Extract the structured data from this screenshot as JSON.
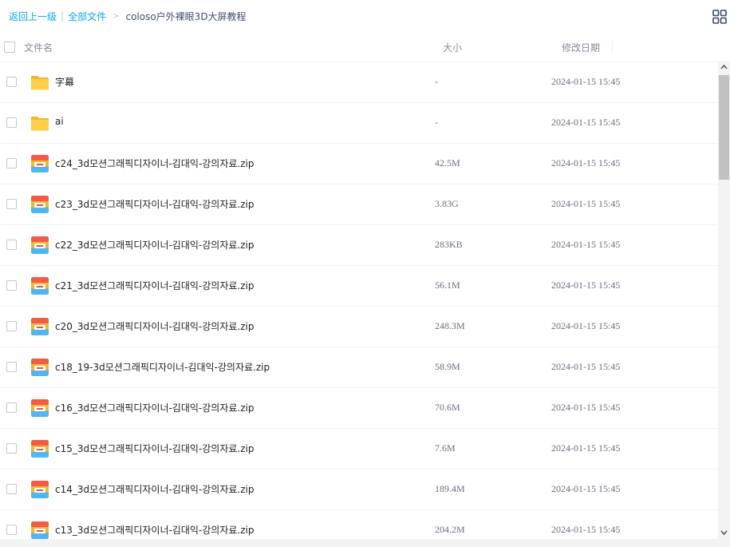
{
  "breadcrumb": {
    "back": "返回上一级",
    "separator": "|",
    "all_files": "全部文件",
    "arrow": ">",
    "current": "coloso户外裸眼3D大屏教程"
  },
  "header": {
    "name": "文件名",
    "size": "大小",
    "date": "修改日期"
  },
  "files": [
    {
      "icon": "folder-icon",
      "name": "字幕",
      "size": "-",
      "date": "2024-01-15 15:45"
    },
    {
      "icon": "folder-icon",
      "name": "ai",
      "size": "-",
      "date": "2024-01-15 15:45"
    },
    {
      "icon": "zip-icon",
      "name": "c24_3d모션그래픽디자이너-김대익-강의자료.zip",
      "size": "42.5M",
      "date": "2024-01-15 15:45"
    },
    {
      "icon": "zip-icon",
      "name": "c23_3d모션그래픽디자이너-김대익-강의자료.zip",
      "size": "3.83G",
      "date": "2024-01-15 15:45"
    },
    {
      "icon": "zip-icon",
      "name": "c22_3d모션그래픽디자이너-김대익-강의자료.zip",
      "size": "283KB",
      "date": "2024-01-15 15:45"
    },
    {
      "icon": "zip-icon",
      "name": "c21_3d모션그래픽디자이너-김대익-강의자료.zip",
      "size": "56.1M",
      "date": "2024-01-15 15:45"
    },
    {
      "icon": "zip-icon",
      "name": "c20_3d모션그래픽디자이너-김대익-강의자료.zip",
      "size": "248.3M",
      "date": "2024-01-15 15:45"
    },
    {
      "icon": "zip-icon",
      "name": "c18_19-3d모션그래픽디자이너-김대익-강의자료.zip",
      "size": "58.9M",
      "date": "2024-01-15 15:45"
    },
    {
      "icon": "zip-icon",
      "name": "c16_3d모션그래픽디자이너-김대익-강의자료.zip",
      "size": "70.6M",
      "date": "2024-01-15 15:45"
    },
    {
      "icon": "zip-icon",
      "name": "c15_3d모션그래픽디자이너-김대익-강의자료.zip",
      "size": "7.6M",
      "date": "2024-01-15 15:45"
    },
    {
      "icon": "zip-icon",
      "name": "c14_3d모션그래픽디자이너-김대익-강의자료.zip",
      "size": "189.4M",
      "date": "2024-01-15 15:45"
    },
    {
      "icon": "zip-icon",
      "name": "c13_3d모션그래픽디자이너-김대익-강의자료.zip",
      "size": "204.2M",
      "date": "2024-01-15 15:45"
    }
  ],
  "toolbar": {
    "view_toggle_icon": "grid-view-icon"
  },
  "colors": {
    "link": "#06a7ff",
    "folder": "#ffc83d",
    "header_text": "#878c9c"
  }
}
